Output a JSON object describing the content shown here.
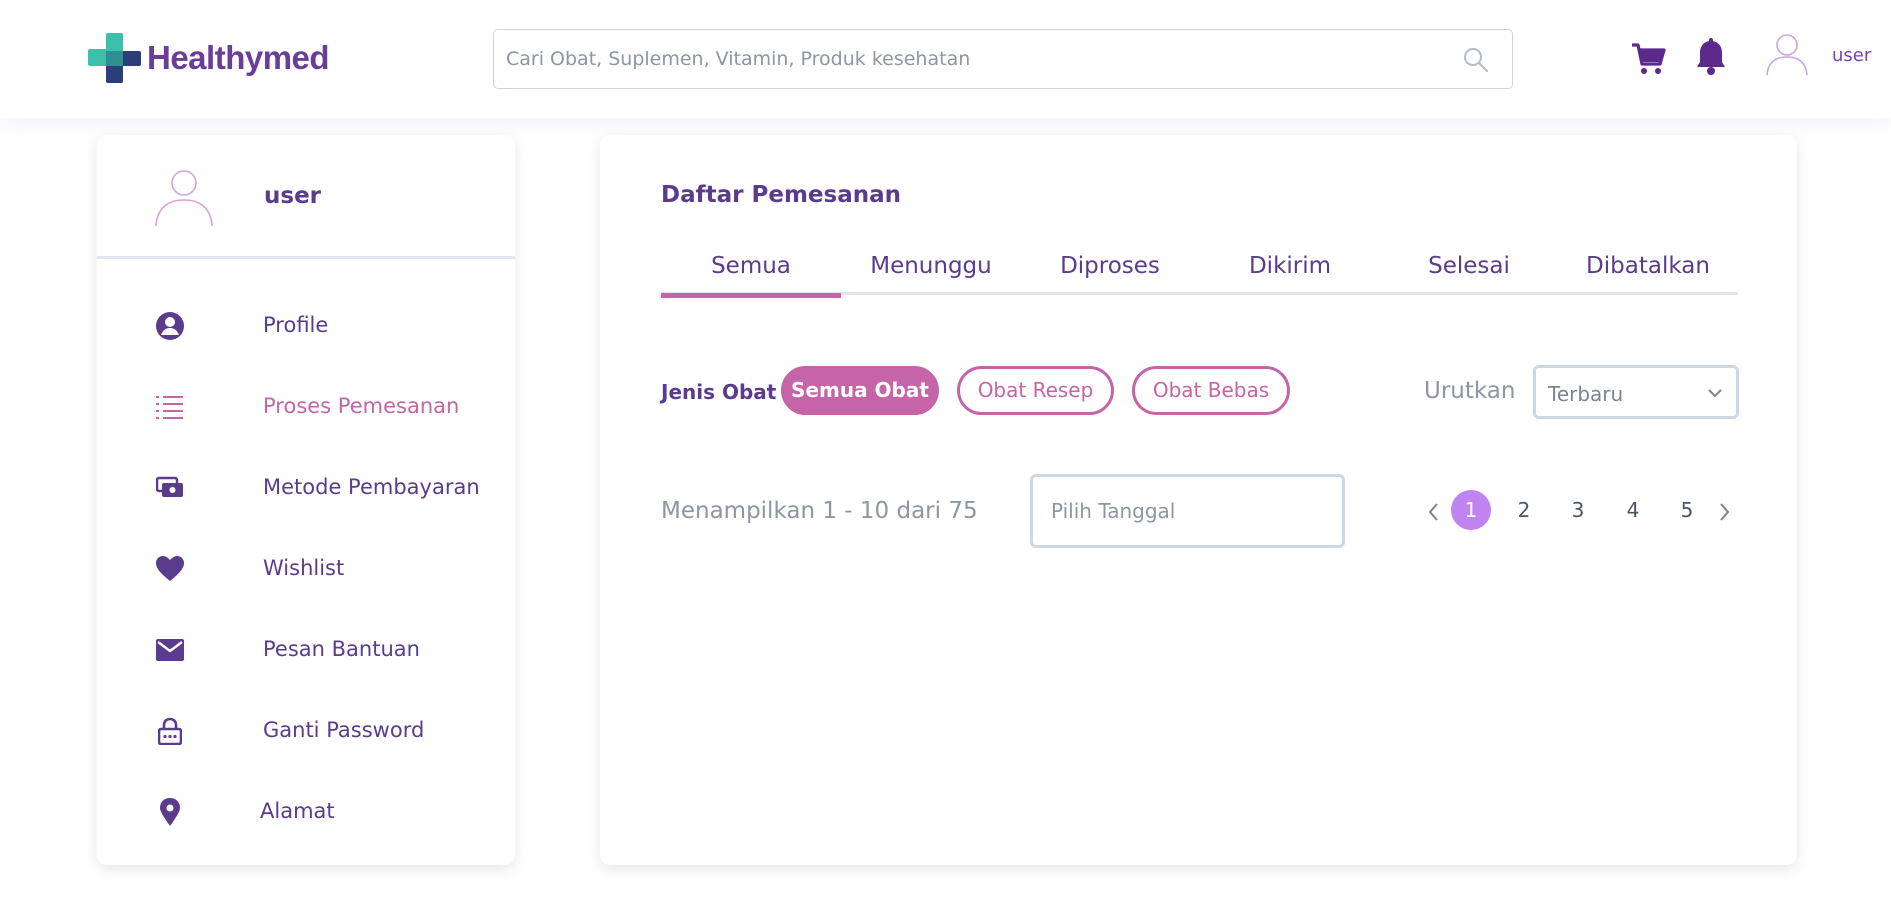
{
  "brand": {
    "name": "Healthymed"
  },
  "search": {
    "placeholder": "Cari Obat, Suplemen, Vitamin, Produk kesehatan"
  },
  "header": {
    "username": "user"
  },
  "sidebar": {
    "username": "user",
    "items": [
      {
        "label": "Profile",
        "icon": "user-circle-icon"
      },
      {
        "label": "Proses Pemesanan",
        "icon": "list-icon",
        "active": true
      },
      {
        "label": "Metode Pembayaran",
        "icon": "payment-icon"
      },
      {
        "label": "Wishlist",
        "icon": "heart-icon"
      },
      {
        "label": "Pesan Bantuan",
        "icon": "mail-icon"
      },
      {
        "label": "Ganti Password",
        "icon": "lock-icon"
      },
      {
        "label": "Alamat",
        "icon": "location-pin-icon"
      }
    ]
  },
  "main": {
    "title": "Daftar Pemesanan",
    "tabs": [
      "Semua",
      "Menunggu",
      "Diproses",
      "Dikirim",
      "Selesai",
      "Dibatalkan"
    ],
    "active_tab": "Semua",
    "filter": {
      "label": "Jenis Obat",
      "chips": [
        "Semua Obat",
        "Obat Resep",
        "Obat Bebas"
      ],
      "active": "Semua Obat"
    },
    "sort": {
      "label": "Urutkan",
      "value": "Terbaru"
    },
    "count_text": "Menampilkan 1 - 10 dari 75",
    "date": {
      "placeholder": "Pilih Tanggal"
    },
    "pagination": {
      "pages": [
        "1",
        "2",
        "3",
        "4",
        "5"
      ],
      "current": "1"
    }
  },
  "colors": {
    "primary": "#5b3b8c",
    "accent": "#c565a8",
    "page_active": "#c084f0",
    "logo_teal": "#3dbfae",
    "logo_navy": "#2c3e77"
  }
}
